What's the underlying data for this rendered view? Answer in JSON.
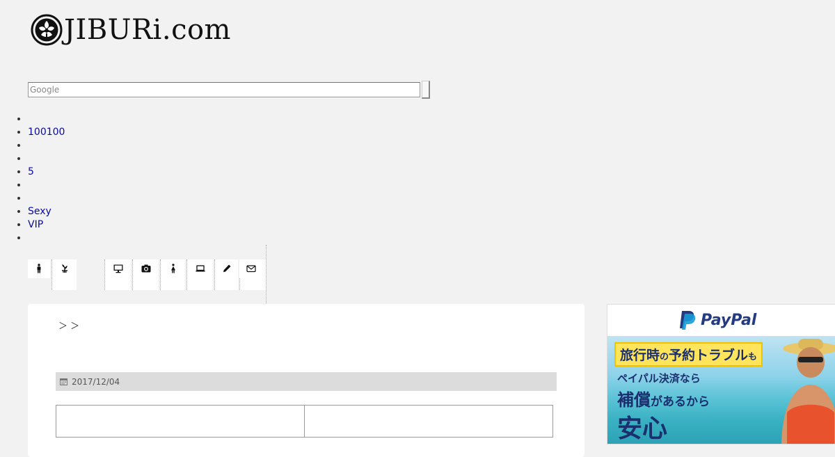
{
  "header": {
    "site_name": "JIBURi.com",
    "logo_icon": "flower-crest-icon"
  },
  "search": {
    "placeholder": "Google"
  },
  "nav": {
    "items": [
      "",
      "100100",
      "",
      "",
      "5",
      "",
      "",
      "Sexy",
      "VIP",
      ""
    ]
  },
  "icon_bar": {
    "icons": [
      "man-icon",
      "plant-icon",
      "monitor-icon",
      "camera-icon",
      "woman-icon",
      "laptop-icon",
      "pencil-icon",
      "bell-icon",
      "envelope-icon"
    ]
  },
  "article": {
    "breadcrumb": "＞ ＞",
    "date_icon": "calendar-icon",
    "date": "2017/12/04"
  },
  "ad": {
    "brand": "PayPal",
    "headline_1": "旅行時",
    "headline_1_particle": "の",
    "headline_1b": "予約トラブル",
    "headline_1c": "も",
    "line_2": "ペイパル決済なら",
    "line_3a": "補償",
    "line_3b": "があるから",
    "line_4": "安心",
    "colors": {
      "brand_dark": "#253b80",
      "brand_light": "#179bd7",
      "highlight": "#ffe45c"
    }
  }
}
